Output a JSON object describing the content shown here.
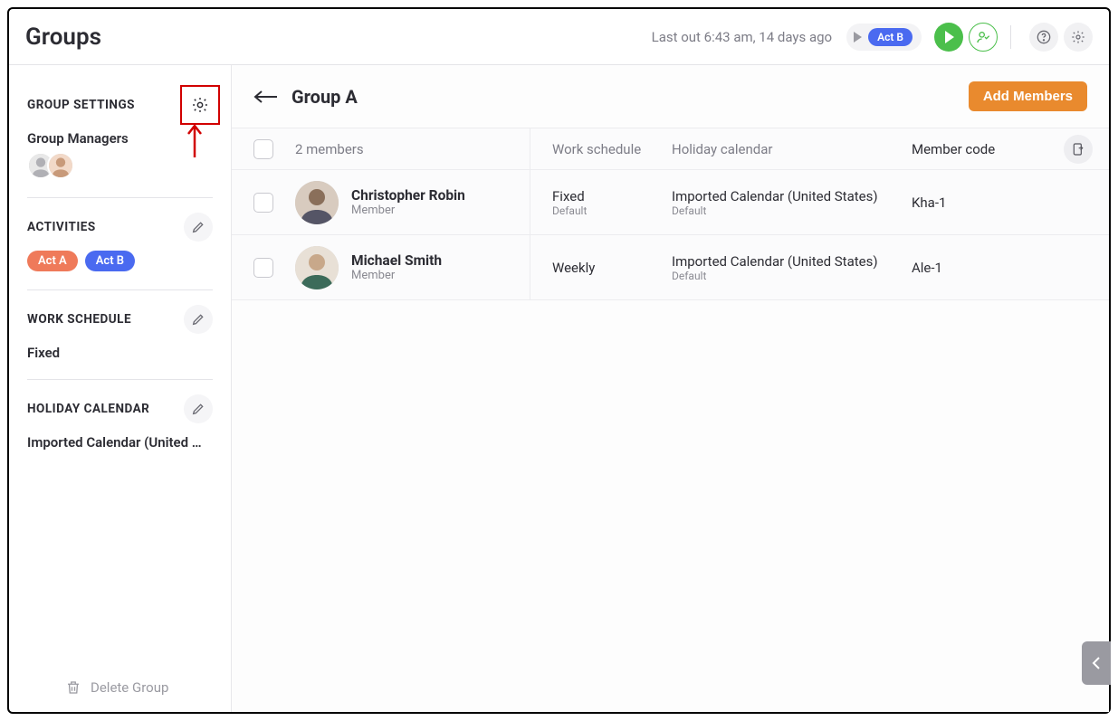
{
  "header": {
    "title": "Groups",
    "status": "Last out 6:43 am, 14 days ago",
    "quick_activity": "Act B"
  },
  "sidebar": {
    "settings_title": "GROUP SETTINGS",
    "managers_label": "Group Managers",
    "activities_title": "ACTIVITIES",
    "activities": [
      {
        "label": "Act A",
        "color": "orange"
      },
      {
        "label": "Act B",
        "color": "blue"
      }
    ],
    "schedule_title": "WORK SCHEDULE",
    "schedule_value": "Fixed",
    "calendar_title": "HOLIDAY CALENDAR",
    "calendar_value": "Imported Calendar (United …",
    "delete_label": "Delete Group"
  },
  "main": {
    "title": "Group A",
    "add_btn": "Add Members",
    "columns": {
      "count": "2 members",
      "schedule": "Work schedule",
      "holiday": "Holiday calendar",
      "code": "Member code"
    },
    "rows": [
      {
        "name": "Christopher Robin",
        "role": "Member",
        "schedule": "Fixed",
        "schedule_sub": "Default",
        "holiday": "Imported Calendar (United States)",
        "holiday_sub": "Default",
        "code": "Kha-1"
      },
      {
        "name": "Michael Smith",
        "role": "Member",
        "schedule": "Weekly",
        "schedule_sub": "",
        "holiday": "Imported Calendar (United States)",
        "holiday_sub": "Default",
        "code": "Ale-1"
      }
    ]
  }
}
